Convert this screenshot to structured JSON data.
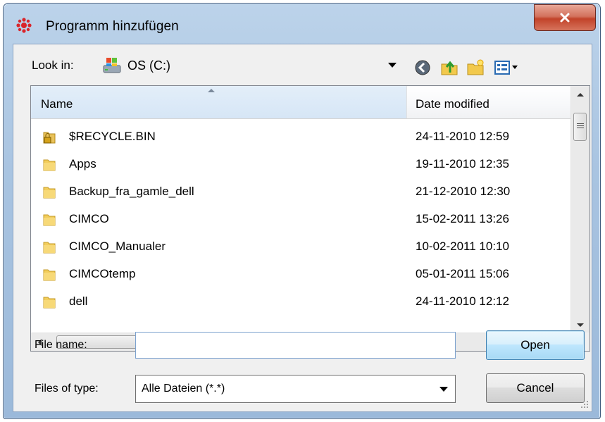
{
  "window": {
    "title": "Programm hinzufügen"
  },
  "toolbar": {
    "look_in_label": "Look in:",
    "look_in_value": "OS (C:)"
  },
  "columns": {
    "name": "Name",
    "date_modified": "Date modified"
  },
  "files": [
    {
      "name": "$RECYCLE.BIN",
      "date": "24-11-2010 12:59",
      "icon": "locked-folder-icon"
    },
    {
      "name": "Apps",
      "date": "19-11-2010 12:35",
      "icon": "folder-icon"
    },
    {
      "name": "Backup_fra_gamle_dell",
      "date": "21-12-2010 12:30",
      "icon": "folder-icon"
    },
    {
      "name": "CIMCO",
      "date": "15-02-2011 13:26",
      "icon": "folder-icon"
    },
    {
      "name": "CIMCO_Manualer",
      "date": "10-02-2011 10:10",
      "icon": "folder-icon"
    },
    {
      "name": "CIMCOtemp",
      "date": "05-01-2011 15:06",
      "icon": "folder-icon"
    },
    {
      "name": "dell",
      "date": "24-11-2010 12:12",
      "icon": "folder-icon"
    }
  ],
  "form": {
    "file_name_label": "File name:",
    "file_name_value": "",
    "file_type_label": "Files of type:",
    "file_type_value": "Alle Dateien (*.*)"
  },
  "buttons": {
    "open": "Open",
    "cancel": "Cancel"
  }
}
